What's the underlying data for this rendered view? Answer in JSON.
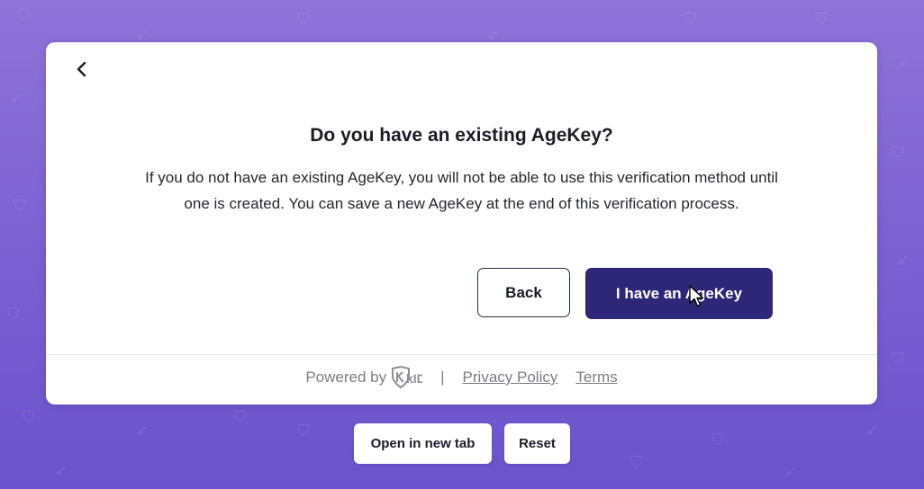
{
  "dialog": {
    "title": "Do you have an existing AgeKey?",
    "body": "If you do not have an existing AgeKey, you will not be able to use this verification method until one is created. You can save a new AgeKey at the end of this verification process.",
    "back_label": "Back",
    "primary_label": "I have an AgeKey"
  },
  "footer": {
    "powered_by": "Powered by",
    "logo_text": "kID",
    "separator": "|",
    "privacy_label": "Privacy Policy",
    "terms_label": "Terms"
  },
  "toolbar": {
    "open_new_tab_label": "Open in new tab",
    "reset_label": "Reset"
  },
  "colors": {
    "background_top": "#8e74d8",
    "background_bottom": "#6a53cc",
    "primary_button": "#2e2677",
    "footer_text": "#7c7c86"
  },
  "icons": {
    "back": "chevron-left-icon",
    "logo": "kid-shield-logo",
    "cursor": "mouse-pointer-icon",
    "pattern": [
      "shield-icon",
      "rocket-icon"
    ]
  }
}
